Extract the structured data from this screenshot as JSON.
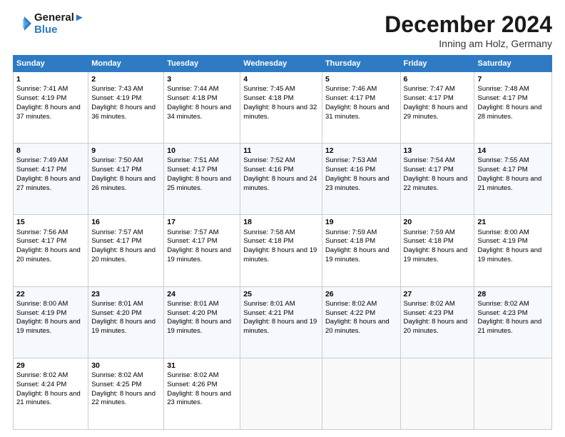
{
  "header": {
    "logo_line1": "General",
    "logo_line2": "Blue",
    "month_title": "December 2024",
    "subtitle": "Inning am Holz, Germany"
  },
  "days_of_week": [
    "Sunday",
    "Monday",
    "Tuesday",
    "Wednesday",
    "Thursday",
    "Friday",
    "Saturday"
  ],
  "weeks": [
    [
      {
        "day": "1",
        "sunrise": "Sunrise: 7:41 AM",
        "sunset": "Sunset: 4:19 PM",
        "daylight": "Daylight: 8 hours and 37 minutes."
      },
      {
        "day": "2",
        "sunrise": "Sunrise: 7:43 AM",
        "sunset": "Sunset: 4:19 PM",
        "daylight": "Daylight: 8 hours and 36 minutes."
      },
      {
        "day": "3",
        "sunrise": "Sunrise: 7:44 AM",
        "sunset": "Sunset: 4:18 PM",
        "daylight": "Daylight: 8 hours and 34 minutes."
      },
      {
        "day": "4",
        "sunrise": "Sunrise: 7:45 AM",
        "sunset": "Sunset: 4:18 PM",
        "daylight": "Daylight: 8 hours and 32 minutes."
      },
      {
        "day": "5",
        "sunrise": "Sunrise: 7:46 AM",
        "sunset": "Sunset: 4:17 PM",
        "daylight": "Daylight: 8 hours and 31 minutes."
      },
      {
        "day": "6",
        "sunrise": "Sunrise: 7:47 AM",
        "sunset": "Sunset: 4:17 PM",
        "daylight": "Daylight: 8 hours and 29 minutes."
      },
      {
        "day": "7",
        "sunrise": "Sunrise: 7:48 AM",
        "sunset": "Sunset: 4:17 PM",
        "daylight": "Daylight: 8 hours and 28 minutes."
      }
    ],
    [
      {
        "day": "8",
        "sunrise": "Sunrise: 7:49 AM",
        "sunset": "Sunset: 4:17 PM",
        "daylight": "Daylight: 8 hours and 27 minutes."
      },
      {
        "day": "9",
        "sunrise": "Sunrise: 7:50 AM",
        "sunset": "Sunset: 4:17 PM",
        "daylight": "Daylight: 8 hours and 26 minutes."
      },
      {
        "day": "10",
        "sunrise": "Sunrise: 7:51 AM",
        "sunset": "Sunset: 4:17 PM",
        "daylight": "Daylight: 8 hours and 25 minutes."
      },
      {
        "day": "11",
        "sunrise": "Sunrise: 7:52 AM",
        "sunset": "Sunset: 4:16 PM",
        "daylight": "Daylight: 8 hours and 24 minutes."
      },
      {
        "day": "12",
        "sunrise": "Sunrise: 7:53 AM",
        "sunset": "Sunset: 4:16 PM",
        "daylight": "Daylight: 8 hours and 23 minutes."
      },
      {
        "day": "13",
        "sunrise": "Sunrise: 7:54 AM",
        "sunset": "Sunset: 4:17 PM",
        "daylight": "Daylight: 8 hours and 22 minutes."
      },
      {
        "day": "14",
        "sunrise": "Sunrise: 7:55 AM",
        "sunset": "Sunset: 4:17 PM",
        "daylight": "Daylight: 8 hours and 21 minutes."
      }
    ],
    [
      {
        "day": "15",
        "sunrise": "Sunrise: 7:56 AM",
        "sunset": "Sunset: 4:17 PM",
        "daylight": "Daylight: 8 hours and 20 minutes."
      },
      {
        "day": "16",
        "sunrise": "Sunrise: 7:57 AM",
        "sunset": "Sunset: 4:17 PM",
        "daylight": "Daylight: 8 hours and 20 minutes."
      },
      {
        "day": "17",
        "sunrise": "Sunrise: 7:57 AM",
        "sunset": "Sunset: 4:17 PM",
        "daylight": "Daylight: 8 hours and 19 minutes."
      },
      {
        "day": "18",
        "sunrise": "Sunrise: 7:58 AM",
        "sunset": "Sunset: 4:18 PM",
        "daylight": "Daylight: 8 hours and 19 minutes."
      },
      {
        "day": "19",
        "sunrise": "Sunrise: 7:59 AM",
        "sunset": "Sunset: 4:18 PM",
        "daylight": "Daylight: 8 hours and 19 minutes."
      },
      {
        "day": "20",
        "sunrise": "Sunrise: 7:59 AM",
        "sunset": "Sunset: 4:18 PM",
        "daylight": "Daylight: 8 hours and 19 minutes."
      },
      {
        "day": "21",
        "sunrise": "Sunrise: 8:00 AM",
        "sunset": "Sunset: 4:19 PM",
        "daylight": "Daylight: 8 hours and 19 minutes."
      }
    ],
    [
      {
        "day": "22",
        "sunrise": "Sunrise: 8:00 AM",
        "sunset": "Sunset: 4:19 PM",
        "daylight": "Daylight: 8 hours and 19 minutes."
      },
      {
        "day": "23",
        "sunrise": "Sunrise: 8:01 AM",
        "sunset": "Sunset: 4:20 PM",
        "daylight": "Daylight: 8 hours and 19 minutes."
      },
      {
        "day": "24",
        "sunrise": "Sunrise: 8:01 AM",
        "sunset": "Sunset: 4:20 PM",
        "daylight": "Daylight: 8 hours and 19 minutes."
      },
      {
        "day": "25",
        "sunrise": "Sunrise: 8:01 AM",
        "sunset": "Sunset: 4:21 PM",
        "daylight": "Daylight: 8 hours and 19 minutes."
      },
      {
        "day": "26",
        "sunrise": "Sunrise: 8:02 AM",
        "sunset": "Sunset: 4:22 PM",
        "daylight": "Daylight: 8 hours and 20 minutes."
      },
      {
        "day": "27",
        "sunrise": "Sunrise: 8:02 AM",
        "sunset": "Sunset: 4:23 PM",
        "daylight": "Daylight: 8 hours and 20 minutes."
      },
      {
        "day": "28",
        "sunrise": "Sunrise: 8:02 AM",
        "sunset": "Sunset: 4:23 PM",
        "daylight": "Daylight: 8 hours and 21 minutes."
      }
    ],
    [
      {
        "day": "29",
        "sunrise": "Sunrise: 8:02 AM",
        "sunset": "Sunset: 4:24 PM",
        "daylight": "Daylight: 8 hours and 21 minutes."
      },
      {
        "day": "30",
        "sunrise": "Sunrise: 8:02 AM",
        "sunset": "Sunset: 4:25 PM",
        "daylight": "Daylight: 8 hours and 22 minutes."
      },
      {
        "day": "31",
        "sunrise": "Sunrise: 8:02 AM",
        "sunset": "Sunset: 4:26 PM",
        "daylight": "Daylight: 8 hours and 23 minutes."
      },
      null,
      null,
      null,
      null
    ]
  ]
}
